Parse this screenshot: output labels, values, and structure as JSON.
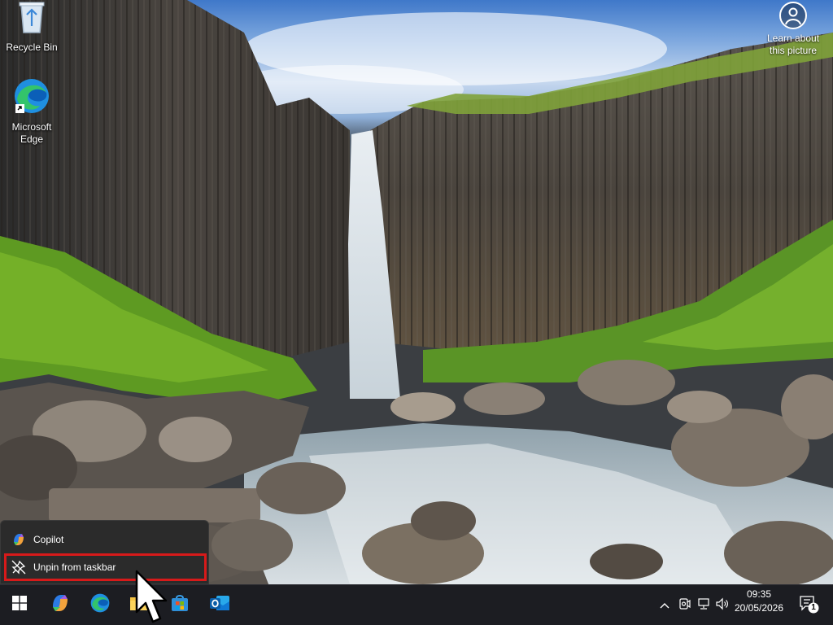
{
  "desktop": {
    "icons": [
      {
        "label": "Recycle Bin",
        "icon": "recycle-bin-icon"
      },
      {
        "label": "Microsoft Edge",
        "icon": "edge-icon"
      }
    ],
    "learn_about": {
      "label": "Learn about this picture",
      "icon": "camera-icon"
    }
  },
  "jump_list": {
    "items": [
      {
        "label": "Copilot",
        "icon": "copilot-icon"
      },
      {
        "label": "Unpin from taskbar",
        "icon": "unpin-icon",
        "highlighted": true
      }
    ],
    "highlight_color": "#d71a1a"
  },
  "taskbar": {
    "pinned": [
      {
        "icon": "windows-start-icon"
      },
      {
        "icon": "copilot-icon"
      },
      {
        "icon": "edge-icon"
      },
      {
        "icon": "file-explorer-icon"
      },
      {
        "icon": "microsoft-store-icon"
      },
      {
        "icon": "outlook-icon"
      }
    ],
    "tray": {
      "icons": [
        "chevron-up-icon",
        "meet-now-icon",
        "network-icon",
        "volume-icon"
      ],
      "time": "09:35",
      "date": "20/05/2026",
      "notification_count": "1"
    }
  }
}
